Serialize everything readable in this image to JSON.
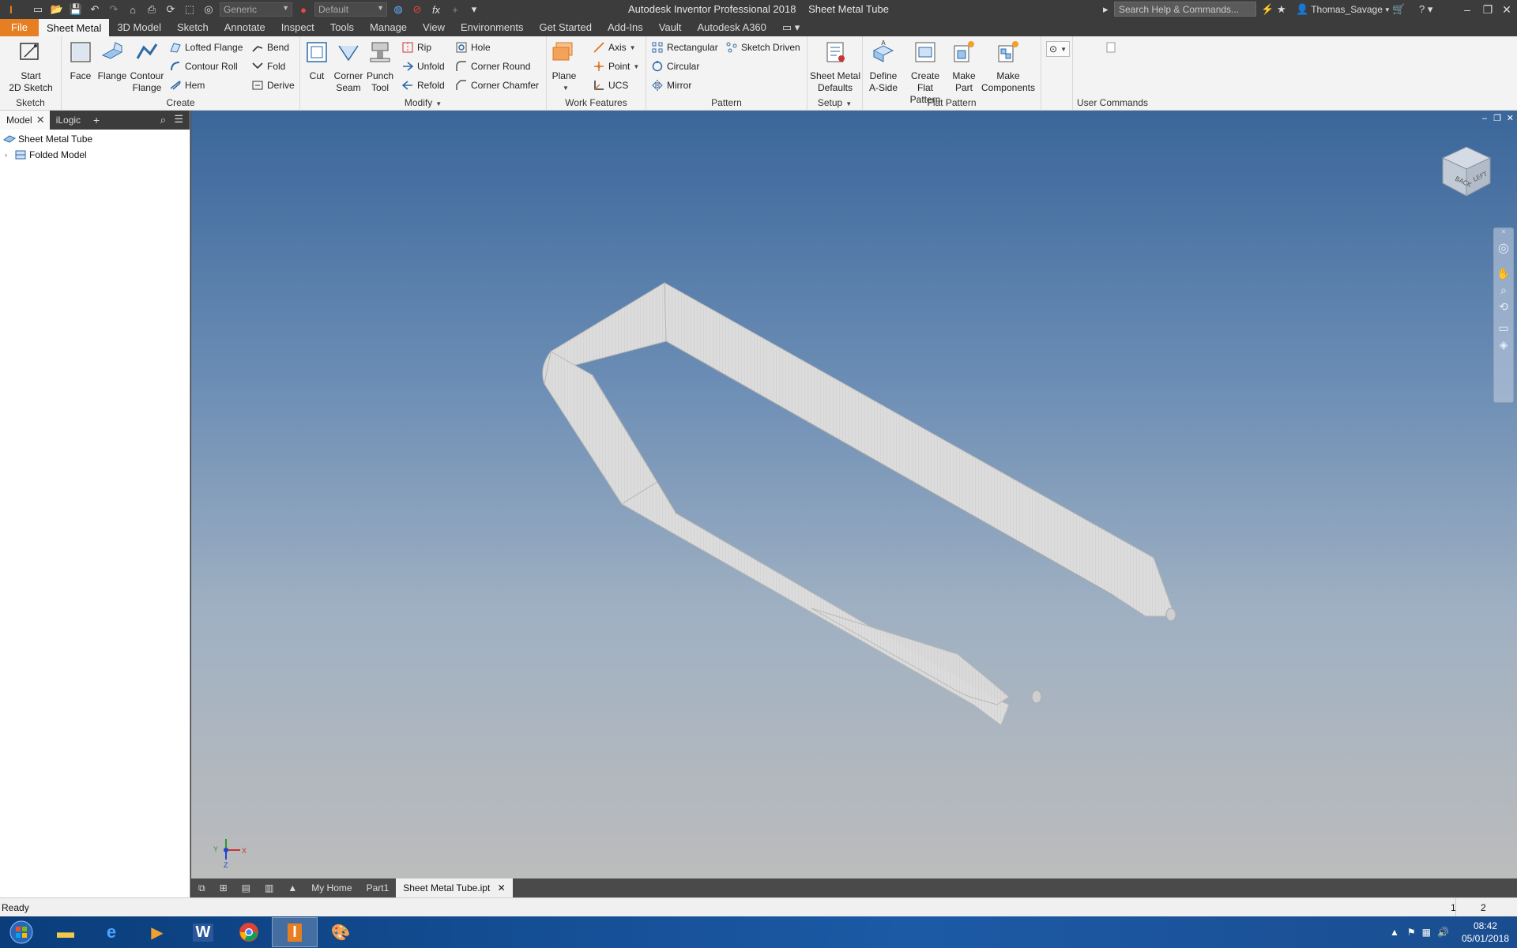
{
  "window": {
    "app_name": "Autodesk Inventor Professional 2018",
    "document_name": "Sheet Metal Tube"
  },
  "quick_access": {
    "appearance_value": "Generic",
    "material_value": "Default",
    "search_placeholder": "Search Help & Commands...",
    "user_name": "Thomas_Savage"
  },
  "ribbon_tabs": [
    "File",
    "Sheet Metal",
    "3D Model",
    "Sketch",
    "Annotate",
    "Inspect",
    "Tools",
    "Manage",
    "View",
    "Environments",
    "Get Started",
    "Add-Ins",
    "Vault",
    "Autodesk A360"
  ],
  "active_tab": "Sheet Metal",
  "ribbon": {
    "sketch_group": {
      "label": "Sketch",
      "start_sketch": "Start\n2D Sketch"
    },
    "create_group": {
      "label": "Create",
      "face": "Face",
      "flange": "Flange",
      "contour_flange": "Contour\nFlange",
      "lofted_flange": "Lofted Flange",
      "contour_roll": "Contour Roll",
      "hem": "Hem",
      "bend": "Bend",
      "fold": "Fold",
      "derive": "Derive"
    },
    "modify_group": {
      "label": "Modify",
      "cut": "Cut",
      "corner_seam": "Corner\nSeam",
      "punch_tool": "Punch\nTool",
      "rip": "Rip",
      "unfold": "Unfold",
      "refold": "Refold",
      "hole": "Hole",
      "corner_round": "Corner Round",
      "corner_chamfer": "Corner Chamfer"
    },
    "work_features_group": {
      "label": "Work Features",
      "plane": "Plane",
      "axis": "Axis",
      "point": "Point",
      "ucs": "UCS"
    },
    "pattern_group": {
      "label": "Pattern",
      "rectangular": "Rectangular",
      "circular": "Circular",
      "mirror": "Mirror",
      "sketch_driven": "Sketch Driven"
    },
    "setup_group": {
      "label": "Setup",
      "defaults": "Sheet Metal\nDefaults"
    },
    "flat_pattern_group": {
      "label": "Flat Pattern",
      "define_a_side": "Define\nA-Side",
      "create_flat_pattern": "Create\nFlat Pattern",
      "make_part": "Make\nPart",
      "make_components": "Make\nComponents"
    },
    "user_commands_group": {
      "label": "User Commands"
    }
  },
  "browser": {
    "tabs": [
      "Model",
      "iLogic"
    ],
    "root": "Sheet Metal Tube",
    "child": "Folded Model"
  },
  "viewcube": {
    "faces": [
      "BACK",
      "LEFT"
    ]
  },
  "triad": {
    "x": "X",
    "y": "Y",
    "z": "Z"
  },
  "document_tabs": [
    "My Home",
    "Part1",
    "Sheet Metal Tube.ipt"
  ],
  "active_document_tab": "Sheet Metal Tube.ipt",
  "status": {
    "text": "Ready",
    "count1": "1",
    "count2": "2"
  },
  "taskbar": {
    "time": "08:42",
    "date": "05/01/2018"
  },
  "colors": {
    "title_bg": "#3c3c3c",
    "file_tab": "#e67e22",
    "ribbon_bg": "#f3f3f3",
    "viewport_top": "#3a669a",
    "viewport_bottom": "#bcbcbc",
    "tube_fill": "#d9d9d9"
  }
}
